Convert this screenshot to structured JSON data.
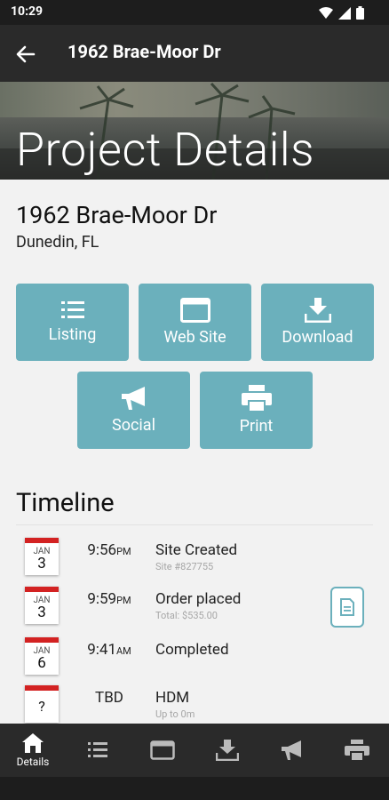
{
  "status_bar": {
    "time": "10:29"
  },
  "app_bar": {
    "title": "1962 Brae-Moor Dr"
  },
  "hero": {
    "title": "Project Details"
  },
  "property": {
    "address": "1962 Brae-Moor Dr",
    "city": "Dunedin, FL"
  },
  "actions": [
    {
      "label": "Listing",
      "icon": "list-icon"
    },
    {
      "label": "Web Site",
      "icon": "browser-window-icon"
    },
    {
      "label": "Download",
      "icon": "download-icon"
    },
    {
      "label": "Social",
      "icon": "megaphone-icon"
    },
    {
      "label": "Print",
      "icon": "printer-icon"
    }
  ],
  "timeline": {
    "heading": "Timeline",
    "events": [
      {
        "month": "JAN",
        "day": "3",
        "time": "9:56",
        "ampm": "PM",
        "title": "Site Created",
        "subtitle": "Site #827755"
      },
      {
        "month": "JAN",
        "day": "3",
        "time": "9:59",
        "ampm": "PM",
        "title": "Order placed",
        "subtitle": "Total: $535.00"
      },
      {
        "month": "JAN",
        "day": "6",
        "time": "9:41",
        "ampm": "AM",
        "title": "Completed",
        "subtitle": ""
      },
      {
        "month": "",
        "day": "?",
        "time": "TBD",
        "ampm": "",
        "title": "HDM",
        "subtitle": "Up to 0m"
      }
    ]
  },
  "bottom_nav": {
    "details_label": "Details"
  },
  "colors": {
    "accent": "#6bb0bc",
    "calendar_red": "#d32222",
    "app_bar": "#2a2a2a"
  }
}
